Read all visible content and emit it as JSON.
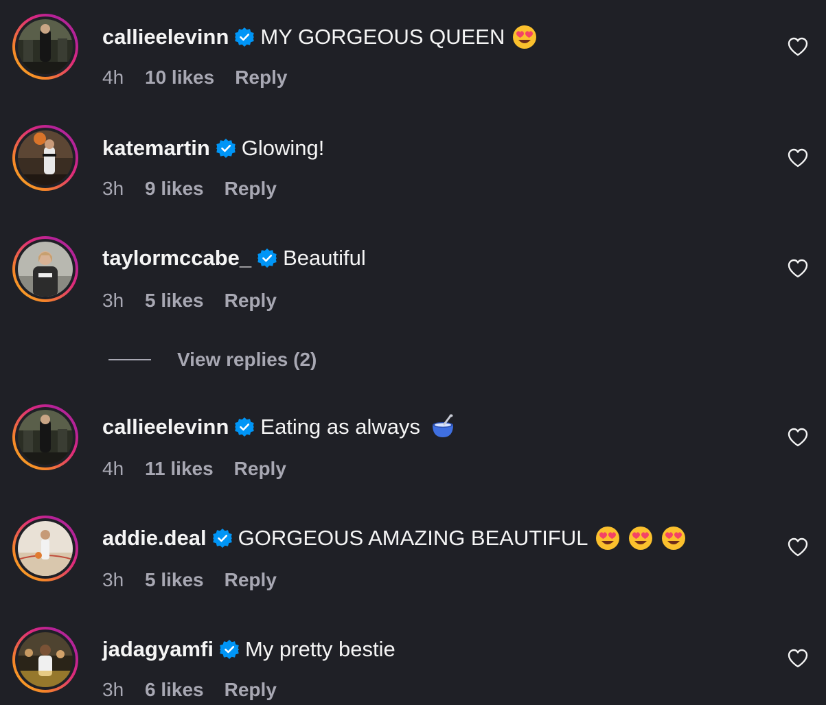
{
  "comments": [
    {
      "username": "callieelevinn",
      "text": "MY GORGEOUS QUEEN",
      "emojis": [
        "heart-eyes-emoji"
      ],
      "time": "4h",
      "likes": "10 likes",
      "reply": "Reply"
    },
    {
      "username": "katemartin",
      "text": "Glowing!",
      "emojis": [],
      "time": "3h",
      "likes": "9 likes",
      "reply": "Reply"
    },
    {
      "username": "taylormccabe_",
      "text": "Beautiful",
      "emojis": [],
      "time": "3h",
      "likes": "5 likes",
      "reply": "Reply"
    },
    {
      "username": "callieelevinn",
      "text": "Eating as always",
      "emojis": [
        "bowl-with-spoon-emoji"
      ],
      "time": "4h",
      "likes": "11 likes",
      "reply": "Reply"
    },
    {
      "username": "addie.deal",
      "text": "GORGEOUS AMAZING BEAUTIFUL",
      "emojis": [
        "heart-eyes-emoji",
        "heart-eyes-emoji",
        "heart-eyes-emoji"
      ],
      "time": "3h",
      "likes": "5 likes",
      "reply": "Reply"
    },
    {
      "username": "jadagyamfi",
      "text": "My pretty bestie",
      "emojis": [],
      "time": "3h",
      "likes": "6 likes",
      "reply": "Reply"
    }
  ],
  "view_replies": "View replies (2)",
  "colors": {
    "background": "#1f2026",
    "primary_text": "#f5f5f5",
    "secondary_text": "#a8a8b3",
    "verified_blue": "#0095f6"
  }
}
